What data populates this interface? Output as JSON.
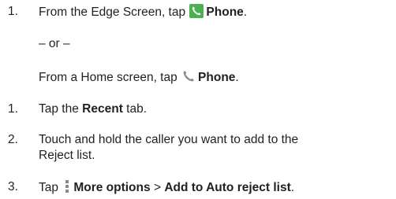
{
  "steps_a": {
    "step1": {
      "number": "1.",
      "prefix": "From the Edge Screen, tap",
      "target": "Phone",
      "suffix": ".",
      "icon": "phone-app-icon-green"
    },
    "or_text": "– or –",
    "alt": {
      "prefix": "From a Home screen, tap",
      "target": "Phone",
      "suffix": ".",
      "icon": "phone-handset-icon"
    }
  },
  "steps_b": [
    {
      "number": "1.",
      "prefix": "Tap the",
      "bold": "Recent",
      "suffix": "tab."
    },
    {
      "number": "2.",
      "line1": "Touch and hold the caller you want to add to the",
      "line2": "Reject list."
    },
    {
      "number": "3.",
      "prefix": "Tap",
      "icon": "more-options-icon",
      "bold1": "More options",
      "sep": ">",
      "bold2": "Add to Auto reject list",
      "suffix": "."
    }
  ],
  "colors": {
    "text": "#231f20",
    "phone_icon_bg": "#4caf50",
    "handset_icon": "#8a8a8a"
  }
}
